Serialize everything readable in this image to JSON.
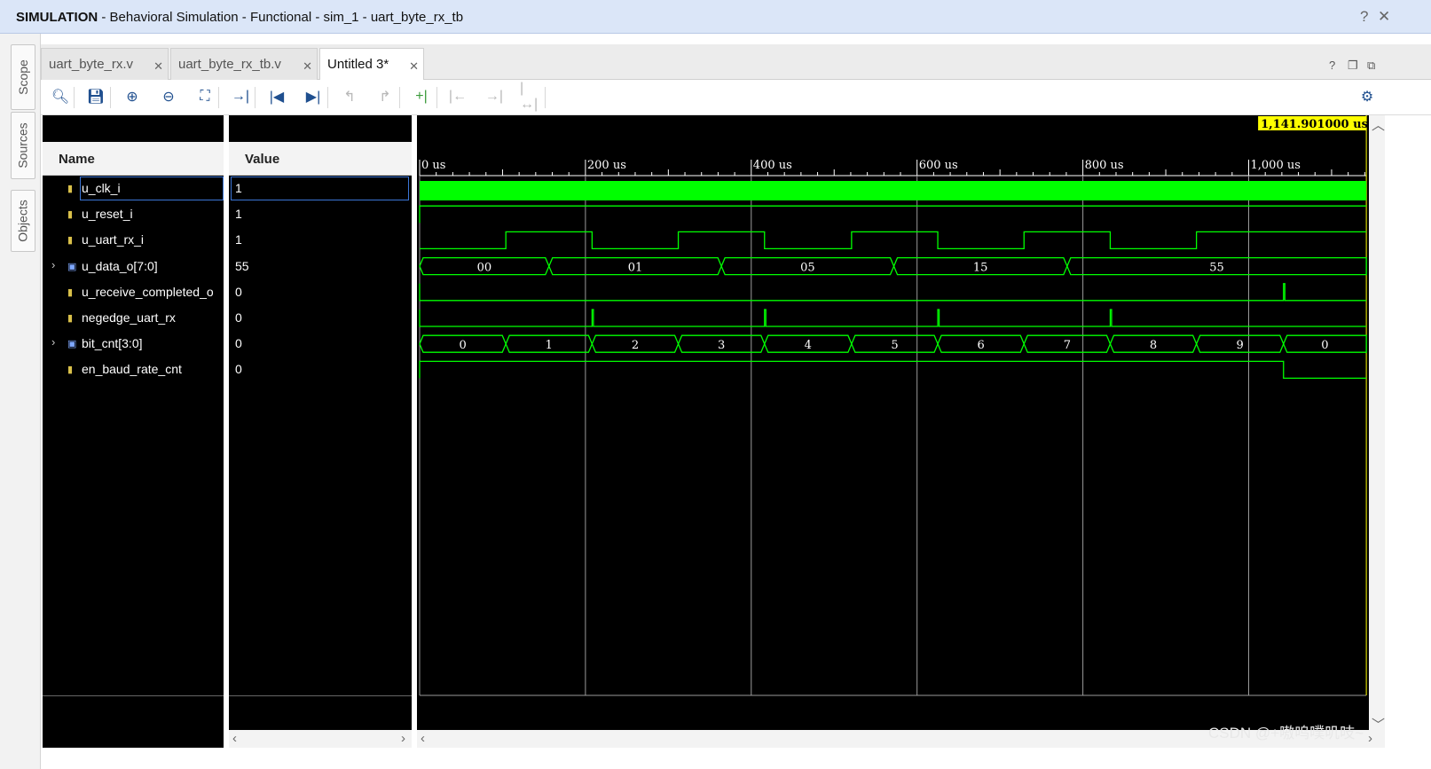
{
  "window": {
    "title_bold": "SIMULATION",
    "title_rest": " - Behavioral Simulation - Functional - sim_1 - uart_byte_rx_tb",
    "help_icon": "question-icon",
    "close_icon": "close-icon"
  },
  "side_tabs": [
    {
      "label": "Scope"
    },
    {
      "label": "Sources"
    },
    {
      "label": "Objects"
    }
  ],
  "tabs": [
    {
      "label": "uart_byte_rx.v",
      "active": false
    },
    {
      "label": "uart_byte_rx_tb.v",
      "active": false
    },
    {
      "label": "Untitled 3*",
      "active": true
    }
  ],
  "panel_icons": [
    "question-icon",
    "restore-icon",
    "maximize-icon"
  ],
  "toolbar": {
    "tools": [
      {
        "name": "search",
        "icon": "search-icon",
        "glyph": "🔍︎",
        "enabled": true
      },
      {
        "name": "save",
        "icon": "save-icon",
        "glyph": "💾︎",
        "enabled": true
      },
      {
        "name": "zoom-in",
        "icon": "zoom-in-icon",
        "glyph": "⊕",
        "enabled": true
      },
      {
        "name": "zoom-out",
        "icon": "zoom-out-icon",
        "glyph": "⊖",
        "enabled": true
      },
      {
        "name": "zoom-fit",
        "icon": "zoom-fit-icon",
        "glyph": "⛶",
        "enabled": true
      },
      {
        "name": "go-to-cursor",
        "icon": "go-to-cursor-icon",
        "glyph": "→|",
        "enabled": true
      },
      {
        "name": "go-to-start",
        "icon": "go-to-start-icon",
        "glyph": "|◀",
        "enabled": true
      },
      {
        "name": "go-to-end",
        "icon": "go-to-end-icon",
        "glyph": "▶|",
        "enabled": true
      },
      {
        "name": "previous-transition",
        "icon": "previous-transition-icon",
        "glyph": "↰",
        "enabled": false
      },
      {
        "name": "next-transition",
        "icon": "next-transition-icon",
        "glyph": "↱",
        "enabled": false
      },
      {
        "name": "add-marker",
        "icon": "add-marker-icon",
        "glyph": "+|",
        "enabled": true,
        "accent": true
      },
      {
        "name": "previous-marker",
        "icon": "previous-marker-icon",
        "glyph": "|←",
        "enabled": false
      },
      {
        "name": "next-marker",
        "icon": "next-marker-icon",
        "glyph": "→|",
        "enabled": false
      },
      {
        "name": "swap-cursors",
        "icon": "swap-cursors-icon",
        "glyph": "|↔|",
        "enabled": false
      }
    ],
    "settings_icon": "gear-icon"
  },
  "columns": {
    "name": "Name",
    "value": "Value"
  },
  "signals": [
    {
      "name": "u_clk_i",
      "value": "1",
      "type": "bit",
      "selected": true
    },
    {
      "name": "u_reset_i",
      "value": "1",
      "type": "bit"
    },
    {
      "name": "u_uart_rx_i",
      "value": "1",
      "type": "bit"
    },
    {
      "name": "u_data_o[7:0]",
      "value": "55",
      "type": "bus",
      "expandable": true
    },
    {
      "name": "u_receive_completed_o",
      "value": "0",
      "type": "bit"
    },
    {
      "name": "negedge_uart_rx",
      "value": "0",
      "type": "bit"
    },
    {
      "name": "bit_cnt[3:0]",
      "value": "0",
      "type": "bus",
      "expandable": true
    },
    {
      "name": "en_baud_rate_cnt",
      "value": "0",
      "type": "bit"
    }
  ],
  "waveform": {
    "cursor_label": "1,141.901000 us",
    "cursor_time_us": 1141.901,
    "time_range_us": [
      0,
      1141.901
    ],
    "major_ticks": [
      {
        "t": 0,
        "label": "0 us"
      },
      {
        "t": 200,
        "label": "200 us"
      },
      {
        "t": 400,
        "label": "400 us"
      },
      {
        "t": 600,
        "label": "600 us"
      },
      {
        "t": 800,
        "label": "800 us"
      },
      {
        "t": 1000,
        "label": "1,000 us"
      }
    ],
    "wave_color": "#00ff00",
    "cursor_color": "#ffff00",
    "traces": {
      "u_rx": [
        [
          0,
          0
        ],
        [
          104,
          1
        ],
        [
          208,
          0
        ],
        [
          312,
          1
        ],
        [
          416,
          0
        ],
        [
          521,
          1
        ],
        [
          625,
          0
        ],
        [
          729,
          1
        ],
        [
          833,
          0
        ],
        [
          937,
          1
        ]
      ],
      "u_data": [
        {
          "start": 0,
          "end": 156,
          "label": "00"
        },
        {
          "start": 156,
          "end": 364,
          "label": "01"
        },
        {
          "start": 364,
          "end": 572,
          "label": "05"
        },
        {
          "start": 572,
          "end": 781,
          "label": "15"
        },
        {
          "start": 781,
          "end": 1141.901,
          "label": "55"
        }
      ],
      "recv_pulse_t": 1042,
      "negedge_pulses": [
        208,
        416,
        625,
        833
      ],
      "bit_cnt": [
        {
          "start": 0,
          "end": 104,
          "label": "0"
        },
        {
          "start": 104,
          "end": 208,
          "label": "1"
        },
        {
          "start": 208,
          "end": 312,
          "label": "2"
        },
        {
          "start": 312,
          "end": 416,
          "label": "3"
        },
        {
          "start": 416,
          "end": 521,
          "label": "4"
        },
        {
          "start": 521,
          "end": 625,
          "label": "5"
        },
        {
          "start": 625,
          "end": 729,
          "label": "6"
        },
        {
          "start": 729,
          "end": 833,
          "label": "7"
        },
        {
          "start": 833,
          "end": 937,
          "label": "8"
        },
        {
          "start": 937,
          "end": 1042,
          "label": "9"
        },
        {
          "start": 1042,
          "end": 1141.901,
          "label": "0"
        }
      ],
      "en_baud_fall_t": 1042
    }
  },
  "watermark": "CSDN @+嗷呜噗叽吱~"
}
